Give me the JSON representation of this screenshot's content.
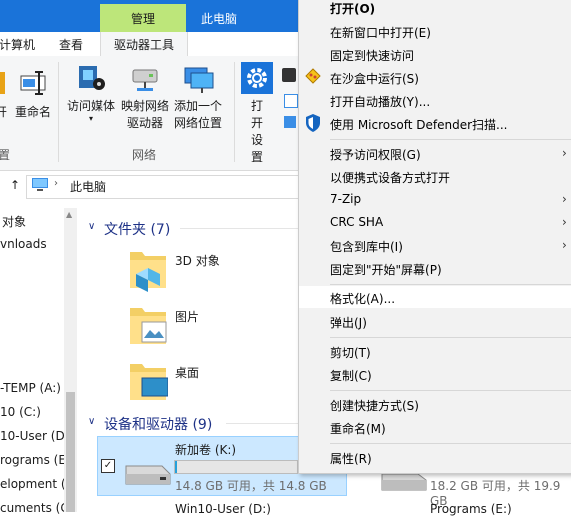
{
  "window": {
    "title": "此电脑",
    "context_tab": "管理"
  },
  "tabs": [
    {
      "label": "计算机"
    },
    {
      "label": "查看"
    },
    {
      "label": "驱动器工具"
    }
  ],
  "ribbon": {
    "buttons": [
      {
        "label": "开"
      },
      {
        "label": "重命名"
      },
      {
        "label": "访问媒体"
      },
      {
        "label": "映射网络驱动器"
      },
      {
        "label": "添加一个网络位置"
      },
      {
        "label": "打开设置"
      }
    ],
    "group_left": "置",
    "group_network": "网络"
  },
  "address": {
    "path": "此电脑"
  },
  "nav": {
    "items": [
      "对象",
      "vnloads",
      "-TEMP (A:)",
      "10 (C:)",
      "10-User (D:",
      "rograms (E:)",
      "elopment (F:",
      "cuments (G:"
    ]
  },
  "content": {
    "folders_header": "文件夹 (7)",
    "folders": [
      {
        "name": "3D 对象"
      },
      {
        "name": "图片"
      },
      {
        "name": "桌面"
      }
    ],
    "devices_header": "设备和驱动器 (9)",
    "drives": [
      {
        "name": "新加卷 (K:)",
        "info": "14.8 GB 可用，共 14.8 GB",
        "used_fraction": 0.02
      },
      {
        "name": "Win10-User (D:)",
        "info": ""
      },
      {
        "name": "Programs (E:)",
        "info": "18.2 GB 可用，共 19.9 GB",
        "used_fraction": 0.09
      }
    ]
  },
  "context_menu": {
    "items": [
      {
        "label": "打开(O)",
        "bold": true
      },
      {
        "label": "在新窗口中打开(E)"
      },
      {
        "label": "固定到快速访问"
      },
      {
        "label": "在沙盒中运行(S)",
        "icon": "sandbox-icon"
      },
      {
        "label": "打开自动播放(Y)..."
      },
      {
        "label": "使用 Microsoft Defender扫描...",
        "icon": "defender-shield-icon"
      },
      {
        "label": "授予访问权限(G)",
        "submenu": true
      },
      {
        "label": "以便携式设备方式打开"
      },
      {
        "label": "7-Zip",
        "submenu": true
      },
      {
        "label": "CRC SHA",
        "submenu": true
      },
      {
        "label": "包含到库中(I)",
        "submenu": true
      },
      {
        "label": "固定到\"开始\"屏幕(P)"
      },
      {
        "label": "格式化(A)...",
        "highlighted": true
      },
      {
        "label": "弹出(J)"
      },
      {
        "label": "剪切(T)"
      },
      {
        "label": "复制(C)"
      },
      {
        "label": "创建快捷方式(S)"
      },
      {
        "label": "重命名(M)"
      },
      {
        "label": "属性(R)"
      }
    ]
  },
  "colors": {
    "title_blue": "#1a73d9",
    "manage_green": "#bde67a",
    "selection_blue": "#cce8ff",
    "menu_bg": "#f2f2f2"
  }
}
